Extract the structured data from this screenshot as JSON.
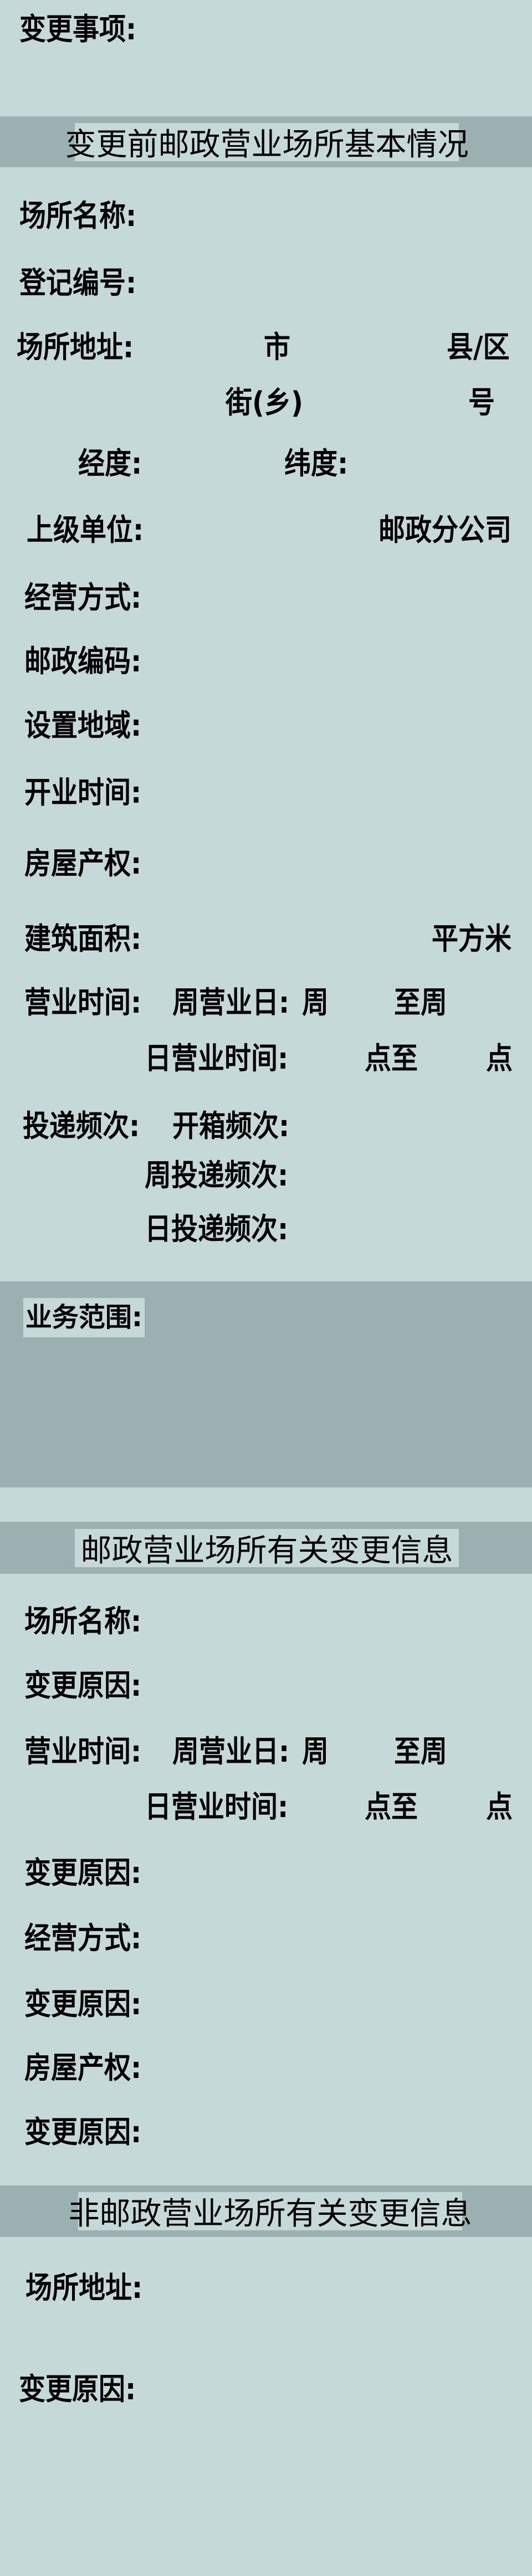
{
  "colors": {
    "background": "#c5d9d9",
    "band": "#9bb0b0",
    "text": "#000000"
  },
  "change_items_label": "变更事项:",
  "section1": {
    "title": "变更前邮政营业场所基本情况",
    "name_label": "场所名称:",
    "reg_no_label": "登记编号:",
    "address_label": "场所地址:",
    "city": "市",
    "county": "县/区",
    "street": "街(乡)",
    "number": "号",
    "longitude_label": "经度:",
    "latitude_label": "纬度:",
    "superior_label": "上级单位:",
    "superior_suffix": "邮政分公司",
    "mode_label": "经营方式:",
    "postcode_label": "邮政编码:",
    "region_label": "设置地域:",
    "opening_label": "开业时间:",
    "property_label": "房屋产权:",
    "area_label": "建筑面积:",
    "area_unit": "平方米",
    "hours_label": "营业时间:",
    "weekdays_label": "周营业日:",
    "week_from": "周",
    "week_to": "至周",
    "daily_hours_label": "日营业时间:",
    "hour_to": "点至",
    "hour_end": "点",
    "delivery_label": "投递频次:",
    "box_freq_label": "开箱频次:",
    "weekly_delivery_label": "周投递频次:",
    "daily_delivery_label": "日投递频次:",
    "scope_label": "业务范围:"
  },
  "section2": {
    "title": "邮政营业场所有关变更信息",
    "name_label": "场所名称:",
    "reason1": "变更原因:",
    "hours_label": "营业时间:",
    "weekdays_label": "周营业日:",
    "week_from": "周",
    "week_to": "至周",
    "daily_hours_label": "日营业时间:",
    "hour_to": "点至",
    "hour_end": "点",
    "reason2": "变更原因:",
    "mode_label": "经营方式:",
    "reason3": "变更原因:",
    "property_label": "房屋产权:",
    "reason4": "变更原因:"
  },
  "section3": {
    "title": "非邮政营业场所有关变更信息",
    "address_label": "场所地址:",
    "reason": "变更原因:"
  }
}
